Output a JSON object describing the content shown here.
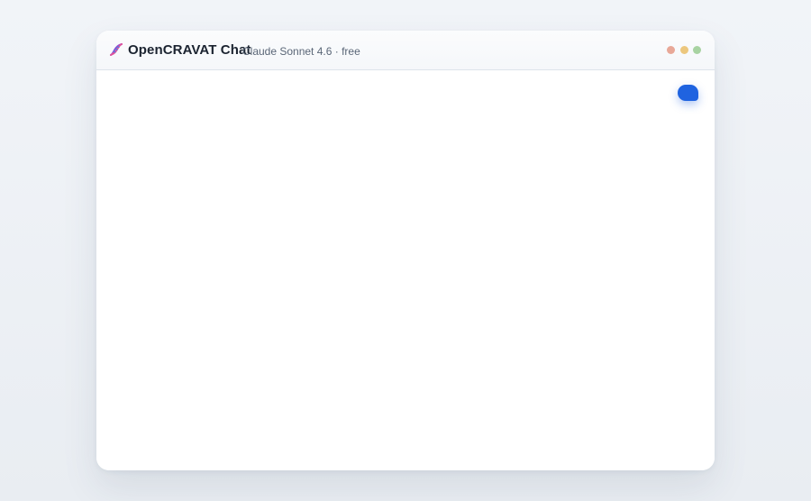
{
  "header": {
    "app_icon": "dna-icon",
    "title": "OpenCRAVAT Chat",
    "model_info": "Claude Sonnet 4.6 · free"
  },
  "window_controls": {
    "colors": {
      "close": "#e8a898",
      "minimize": "#ecc77e",
      "maximize": "#a8d3a2"
    }
  },
  "chat_button": {
    "icon": "chat-bubble-icon",
    "color": "#1f63e0"
  }
}
